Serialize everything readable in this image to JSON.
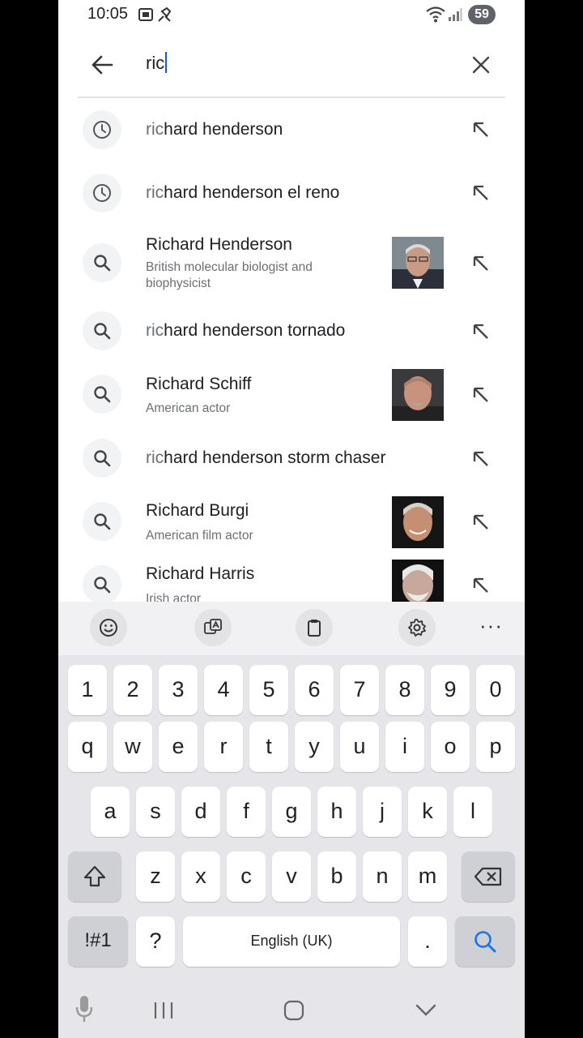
{
  "status_bar": {
    "time": "10:05",
    "battery": "59",
    "icons": [
      "screenshot-icon",
      "satellite-icon",
      "wifi-icon",
      "signal-icon",
      "battery-icon"
    ]
  },
  "search": {
    "query": "ric",
    "icons": [
      "back-arrow-icon",
      "clear-icon"
    ]
  },
  "suggestions": [
    {
      "type": "history",
      "prefix": "ric",
      "rest": "hard henderson",
      "icon": "history-clock-icon"
    },
    {
      "type": "history",
      "prefix": "ric",
      "rest": "hard henderson el reno",
      "icon": "history-clock-icon"
    },
    {
      "type": "entity",
      "title": "Richard Henderson",
      "subtitle": "British molecular biologist and biophysicist",
      "icon": "search-icon",
      "has_image": true
    },
    {
      "type": "query",
      "prefix": "ric",
      "rest": "hard henderson tornado",
      "icon": "search-icon"
    },
    {
      "type": "entity",
      "title": "Richard Schiff",
      "subtitle": "American actor",
      "icon": "search-icon",
      "has_image": true
    },
    {
      "type": "query",
      "prefix": "ric",
      "rest": "hard henderson storm chaser",
      "icon": "search-icon"
    },
    {
      "type": "entity",
      "title": "Richard Burgi",
      "subtitle": "American film actor",
      "icon": "search-icon",
      "has_image": true
    },
    {
      "type": "entity",
      "title": "Richard Harris",
      "subtitle": "Irish actor",
      "icon": "search-icon",
      "has_image": true
    }
  ],
  "keyboard": {
    "toolbar": [
      "emoji-icon",
      "translate-icon",
      "clipboard-icon",
      "settings-icon",
      "more-icon"
    ],
    "more_label": "···",
    "rows": [
      [
        "1",
        "2",
        "3",
        "4",
        "5",
        "6",
        "7",
        "8",
        "9",
        "0"
      ],
      [
        "q",
        "w",
        "e",
        "r",
        "t",
        "y",
        "u",
        "i",
        "o",
        "p"
      ],
      [
        "a",
        "s",
        "d",
        "f",
        "g",
        "h",
        "j",
        "k",
        "l"
      ],
      [
        "z",
        "x",
        "c",
        "v",
        "b",
        "n",
        "m"
      ]
    ],
    "symbols_label": "!#1",
    "question_label": "?",
    "space_label": "English (UK)",
    "period_label": ".",
    "accent_color": "#1a73e8"
  },
  "nav_bar": {
    "icons": [
      "mic-icon",
      "recents-icon",
      "home-icon",
      "hide-keyboard-icon"
    ]
  }
}
